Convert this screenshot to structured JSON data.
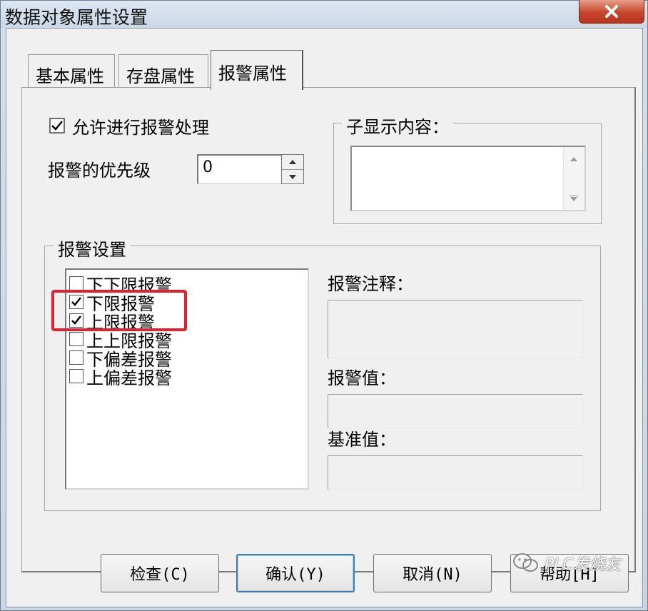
{
  "window": {
    "title": "数据对象属性设置"
  },
  "tabs": [
    {
      "label": "基本属性"
    },
    {
      "label": "存盘属性"
    },
    {
      "label": "报警属性"
    }
  ],
  "alarm_tab": {
    "enable_alarm_label": "允许进行报警处理",
    "enable_alarm_checked": true,
    "priority_label": "报警的优先级",
    "priority_value": "0",
    "sub_display_label": "子显示内容：",
    "alarm_settings_label": "报警设置",
    "alarm_types": [
      {
        "label": "下下限报警",
        "checked": false
      },
      {
        "label": "下限报警",
        "checked": true
      },
      {
        "label": "上限报警",
        "checked": true
      },
      {
        "label": "上上限报警",
        "checked": false
      },
      {
        "label": "下偏差报警",
        "checked": false
      },
      {
        "label": "上偏差报警",
        "checked": false
      }
    ],
    "alarm_note_label": "报警注释：",
    "alarm_value_label": "报警值：",
    "base_value_label": "基准值："
  },
  "buttons": {
    "check": "检查(C)",
    "confirm": "确认(Y)",
    "cancel": "取消(N)",
    "help": "帮助[H]"
  },
  "watermark": "PLC发烧友",
  "colors": {
    "highlight": "#e3212c",
    "close_button": "#c9462d",
    "default_button_border": "#3c7fb1"
  }
}
